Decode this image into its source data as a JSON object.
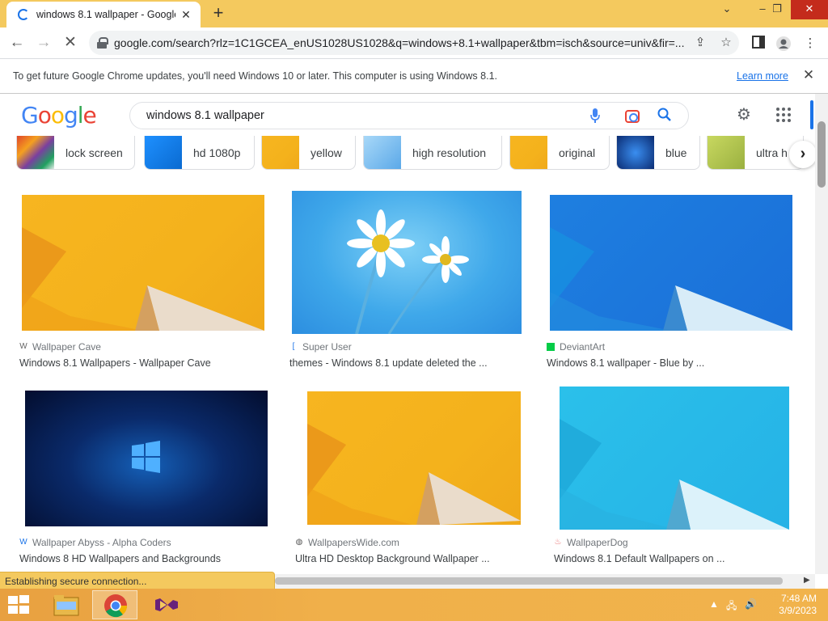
{
  "browser": {
    "tab_title": "windows 8.1 wallpaper - Google",
    "url": "google.com/search?rlz=1C1GCEA_enUS1028US1028&q=windows+8.1+wallpaper&tbm=isch&source=univ&fir=..."
  },
  "infobar": {
    "message": "To get future Google Chrome updates, you'll need Windows 10 or later. This computer is using Windows 8.1.",
    "link": "Learn more"
  },
  "google": {
    "logo": [
      "G",
      "o",
      "o",
      "g",
      "l",
      "e"
    ],
    "query": "windows 8.1 wallpaper"
  },
  "chips": [
    {
      "label": "lock screen"
    },
    {
      "label": "hd 1080p"
    },
    {
      "label": "yellow"
    },
    {
      "label": "high resolution"
    },
    {
      "label": "original"
    },
    {
      "label": "blue"
    },
    {
      "label": "ultra h"
    }
  ],
  "results": [
    {
      "source": "Wallpaper Cave",
      "title": "Windows 8.1 Wallpapers - Wallpaper Cave"
    },
    {
      "source": "Super User",
      "title": "themes - Windows 8.1 update deleted the ..."
    },
    {
      "source": "DeviantArt",
      "title": "Windows 8.1 wallpaper - Blue by ..."
    },
    {
      "source": "Wallpaper Abyss - Alpha Coders",
      "title": "Windows 8 HD Wallpapers and Backgrounds"
    },
    {
      "source": "WallpapersWide.com",
      "title": "Ultra HD Desktop Background Wallpaper ..."
    },
    {
      "source": "WallpaperDog",
      "title": "Windows 8.1 Default Wallpapers on ..."
    }
  ],
  "status_text": "Establishing secure connection...",
  "taskbar": {
    "time": "7:48 AM",
    "date": "3/9/2023"
  },
  "colors": {
    "accent_blue": "#1a73e8",
    "titlebar": "#f4c95e",
    "win81_yellow": "#f7b520",
    "win81_blue": "#1e7fe0",
    "win81_cyan": "#2bc0ea"
  }
}
